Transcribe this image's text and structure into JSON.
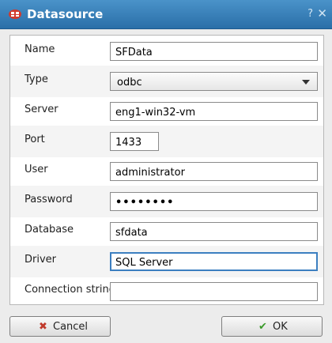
{
  "window": {
    "title": "Datasource",
    "help_glyph": "?",
    "close_glyph": "✕"
  },
  "form": {
    "name": {
      "label": "Name",
      "value": "SFData"
    },
    "type": {
      "label": "Type",
      "value": "odbc"
    },
    "server": {
      "label": "Server",
      "value": "eng1-win32-vm"
    },
    "port": {
      "label": "Port",
      "value": "1433"
    },
    "user": {
      "label": "User",
      "value": "administrator"
    },
    "password": {
      "label": "Password",
      "value": "••••••••"
    },
    "database": {
      "label": "Database",
      "value": "sfdata"
    },
    "driver": {
      "label": "Driver",
      "value": "SQL Server"
    },
    "connection_string": {
      "label": "Connection string",
      "value": ""
    }
  },
  "buttons": {
    "cancel_label": "Cancel",
    "ok_label": "OK"
  },
  "colors": {
    "titlebar": "#2a6fa8",
    "accent": "#3c7fc0",
    "cancel_icon": "#c0392b",
    "ok_icon": "#3a9a2a"
  }
}
